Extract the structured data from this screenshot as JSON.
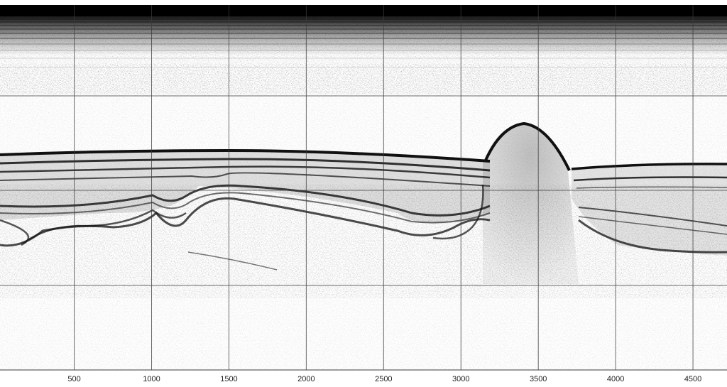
{
  "x_axis": {
    "tick_labels": [
      "500",
      "1000",
      "1500",
      "2000",
      "2500",
      "3000",
      "3500",
      "4000",
      "4500"
    ],
    "range": [
      20,
      4720
    ]
  },
  "colors": {
    "background": "#ffffff",
    "ink": "#111111",
    "grid": "#3a3a3a",
    "top_band": "#000000"
  }
}
